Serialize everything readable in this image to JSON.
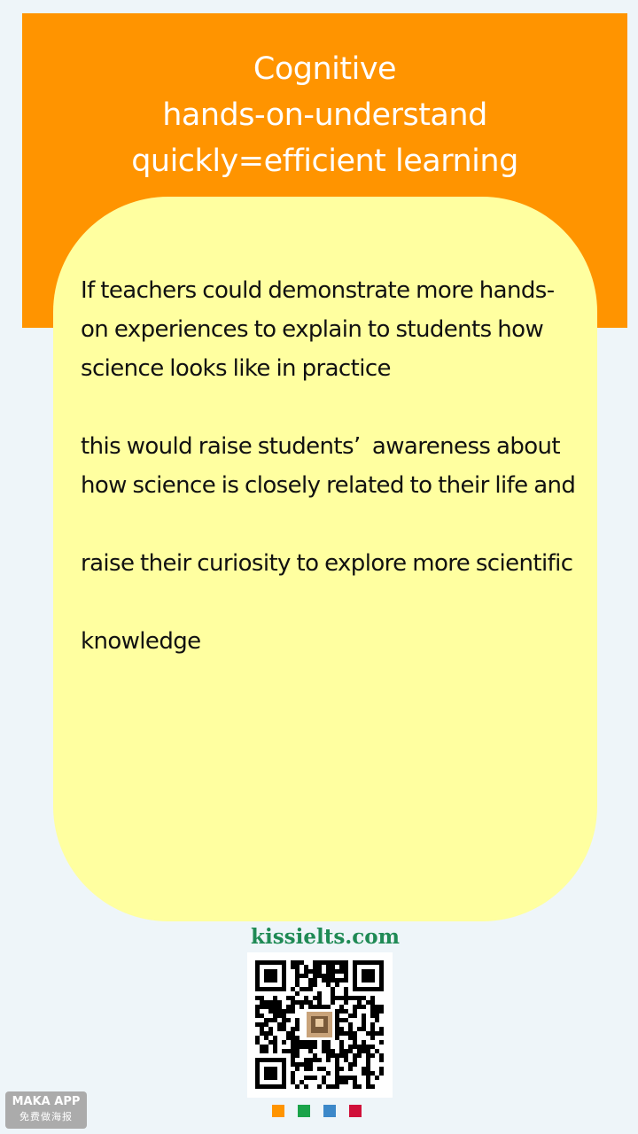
{
  "header": {
    "title_lines": [
      "Cognitive",
      "hands-on-understand",
      "quickly=efficient learning"
    ],
    "background_color": "#ff9400"
  },
  "card": {
    "background_color": "#ffffa0",
    "paragraphs": [
      "If teachers could demonstrate more hands-on experiences to explain to students how science looks like in practice",
      "this would raise students’  awareness about how science is closely related to their life and",
      "raise their curiosity to explore more scientific",
      "knowledge"
    ]
  },
  "footer": {
    "site_url": "kissielts.com",
    "qr_code_icon": "qr-code-icon",
    "brand_badge": {
      "name": "MAKA APP",
      "tagline": "免费做海报"
    },
    "color_dots": [
      "#ff9400",
      "#1aa34a",
      "#3c88c9",
      "#d0103a"
    ]
  }
}
